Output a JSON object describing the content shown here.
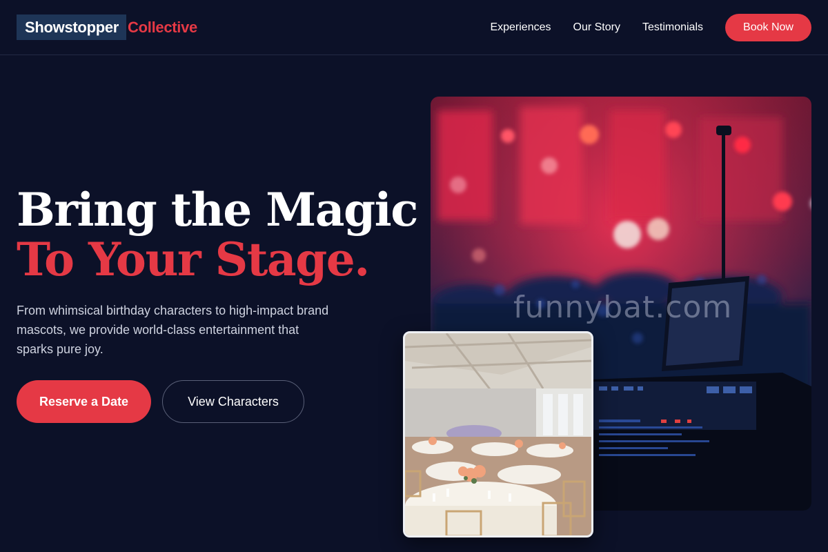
{
  "brand": {
    "name_part1": "Showstopper",
    "name_part2": "Collective"
  },
  "nav": {
    "links": [
      "Experiences",
      "Our Story",
      "Testimonials"
    ],
    "cta": "Book Now"
  },
  "hero": {
    "title_line1": "Bring the Magic",
    "title_line2": "To Your Stage.",
    "subtitle": "From whimsical birthday characters to high-impact brand mascots, we provide world-class entertainment that sparks pure joy.",
    "primary_button": "Reserve a Date",
    "secondary_button": "View Characters"
  },
  "images": {
    "stage_watermark": "funnybat.com"
  },
  "colors": {
    "background": "#0c1128",
    "accent": "#e53945",
    "logo_box": "#1e3557"
  }
}
